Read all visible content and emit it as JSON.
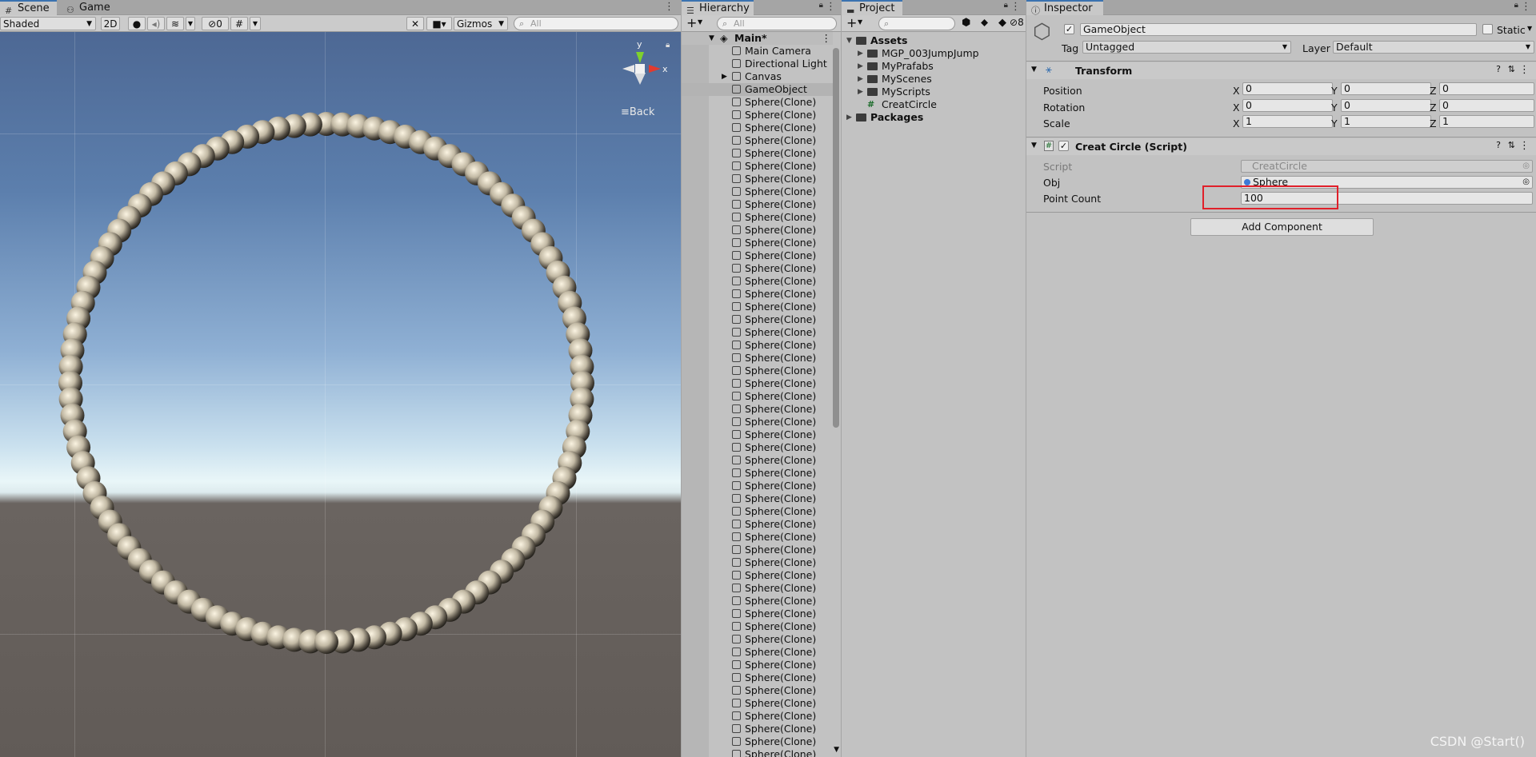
{
  "scene": {
    "tabs": [
      {
        "label": "Scene",
        "icon": "grid-icon"
      },
      {
        "label": "Game",
        "icon": "gamepad-icon"
      }
    ],
    "shading_mode": "Shaded",
    "btn_2d": "2D",
    "hidden_count": "0",
    "gizmos_label": "Gizmos",
    "search_placeholder": "All",
    "gizmo_y": "y",
    "gizmo_x": "x",
    "back_label": "≡Back"
  },
  "hierarchy": {
    "tab_label": "Hierarchy",
    "search_placeholder": "All",
    "scene_name": "Main*",
    "items": [
      "Main Camera",
      "Directional Light",
      "Canvas",
      "GameObject",
      "Sphere(Clone)",
      "Sphere(Clone)",
      "Sphere(Clone)",
      "Sphere(Clone)",
      "Sphere(Clone)",
      "Sphere(Clone)",
      "Sphere(Clone)",
      "Sphere(Clone)",
      "Sphere(Clone)",
      "Sphere(Clone)",
      "Sphere(Clone)",
      "Sphere(Clone)",
      "Sphere(Clone)",
      "Sphere(Clone)",
      "Sphere(Clone)",
      "Sphere(Clone)",
      "Sphere(Clone)",
      "Sphere(Clone)",
      "Sphere(Clone)",
      "Sphere(Clone)",
      "Sphere(Clone)",
      "Sphere(Clone)",
      "Sphere(Clone)",
      "Sphere(Clone)",
      "Sphere(Clone)",
      "Sphere(Clone)",
      "Sphere(Clone)",
      "Sphere(Clone)",
      "Sphere(Clone)",
      "Sphere(Clone)",
      "Sphere(Clone)",
      "Sphere(Clone)",
      "Sphere(Clone)",
      "Sphere(Clone)",
      "Sphere(Clone)",
      "Sphere(Clone)",
      "Sphere(Clone)",
      "Sphere(Clone)",
      "Sphere(Clone)",
      "Sphere(Clone)",
      "Sphere(Clone)",
      "Sphere(Clone)",
      "Sphere(Clone)",
      "Sphere(Clone)",
      "Sphere(Clone)",
      "Sphere(Clone)",
      "Sphere(Clone)",
      "Sphere(Clone)",
      "Sphere(Clone)",
      "Sphere(Clone)",
      "Sphere(Clone)",
      "Sphere(Clone)"
    ],
    "selected": "GameObject"
  },
  "project": {
    "tab_label": "Project",
    "hidden_count": "8",
    "tree": [
      {
        "label": "Assets",
        "kind": "folder",
        "bold": true
      },
      {
        "label": "MGP_003JumpJump",
        "kind": "folder"
      },
      {
        "label": "MyPrafabs",
        "kind": "folder"
      },
      {
        "label": "MyScenes",
        "kind": "folder"
      },
      {
        "label": "MyScripts",
        "kind": "folder"
      },
      {
        "label": "CreatCircle",
        "kind": "script"
      },
      {
        "label": "Packages",
        "kind": "folder",
        "bold": true
      }
    ]
  },
  "inspector": {
    "tab_label": "Inspector",
    "object_name": "GameObject",
    "static_label": "Static",
    "tag_label": "Tag",
    "tag_value": "Untagged",
    "layer_label": "Layer",
    "layer_value": "Default",
    "transform": {
      "title": "Transform",
      "position_label": "Position",
      "rotation_label": "Rotation",
      "scale_label": "Scale",
      "axes": [
        "X",
        "Y",
        "Z"
      ],
      "position": [
        "0",
        "0",
        "0"
      ],
      "rotation": [
        "0",
        "0",
        "0"
      ],
      "scale": [
        "1",
        "1",
        "1"
      ]
    },
    "script_component": {
      "title": "Creat Circle (Script)",
      "script_label": "Script",
      "script_value": "CreatCircle",
      "obj_label": "Obj",
      "obj_value": "Sphere",
      "point_count_label": "Point Count",
      "point_count_value": "100"
    },
    "add_component": "Add Component"
  },
  "watermark": "CSDN @Start()",
  "colors": {
    "accent_tab": "#3a72b0",
    "highlight": "#e0202a",
    "sphere": "#bfb7a3"
  }
}
